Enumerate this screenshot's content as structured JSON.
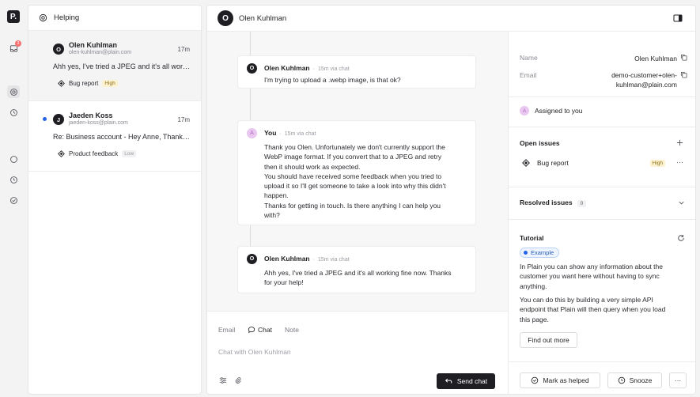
{
  "rail": {
    "logo": "P.",
    "inbox_badge": "3"
  },
  "inbox": {
    "title": "Helping",
    "threads": [
      {
        "initial": "O",
        "name": "Olen Kuhlman",
        "email": "olen-kuhlman@plain.com",
        "time": "17m",
        "preview": "Ahh yes, I've tried a JPEG and it's all wor…",
        "label": "Bug report",
        "priority": "High",
        "unread": false
      },
      {
        "initial": "J",
        "name": "Jaeden Koss",
        "email": "jaeden-koss@plain.com",
        "time": "17m",
        "preview": "Re: Business account - Hey Anne, Thank…",
        "label": "Product feedback",
        "priority": "Low",
        "unread": true
      }
    ]
  },
  "conversation": {
    "initial": "O",
    "customer_name": "Olen Kuhlman",
    "messages": [
      {
        "author": "Olen Kuhlman",
        "initial": "O",
        "meta": "15m via chat",
        "body": [
          "I'm trying to upload a .webp image, is that ok?"
        ]
      },
      {
        "author": "You",
        "initial": "A",
        "meta": "15m via chat",
        "body": [
          "Thank you Olen. Unfortunately we don't currently support the",
          "WebP image format. If you convert that to a JPEG and retry",
          "then it should work as expected.",
          "You should have received some feedback when you tried to",
          "upload it so I'll get someone to take a look into why this didn't",
          "happen.",
          "Thanks for getting in touch. Is there anything I can help you",
          "with?"
        ]
      },
      {
        "author": "Olen Kuhlman",
        "initial": "O",
        "meta": "15m via chat",
        "body": [
          "Ahh yes, I've tried a JPEG and it's all working fine now. Thanks",
          "for your help!"
        ]
      }
    ],
    "composer": {
      "tabs": [
        "Email",
        "Chat",
        "Note"
      ],
      "active_tab": "Chat",
      "placeholder": "Chat with Olen Kuhlman",
      "send_label": "Send chat"
    }
  },
  "details": {
    "name_label": "Name",
    "name_value": "Olen Kuhlman",
    "email_label": "Email",
    "email_lines": [
      "demo-customer+olen-",
      "kuhlman@plain.com"
    ],
    "assigned_initial": "A",
    "assigned_text": "Assigned to you",
    "open_issues_title": "Open issues",
    "open_issue": {
      "label": "Bug report",
      "priority": "High"
    },
    "resolved_title": "Resolved issues",
    "resolved_count": "0",
    "tutorial_title": "Tutorial",
    "example_label": "Example",
    "tutorial_p1": [
      "In Plain you can show any information about the",
      "customer you want here without having to sync",
      "anything."
    ],
    "tutorial_p2": [
      "You can do this by building a very simple API",
      "endpoint that Plain will then query when you load",
      "this page."
    ],
    "find_out_more": "Find out more",
    "mark_helped": "Mark as helped",
    "snooze": "Snooze",
    "more": "···"
  },
  "colors": {
    "accent": "#1f1f23",
    "high_priority_bg": "#fdf2cf",
    "unread_dot": "#2563eb",
    "rail_badge": "#f87171"
  }
}
